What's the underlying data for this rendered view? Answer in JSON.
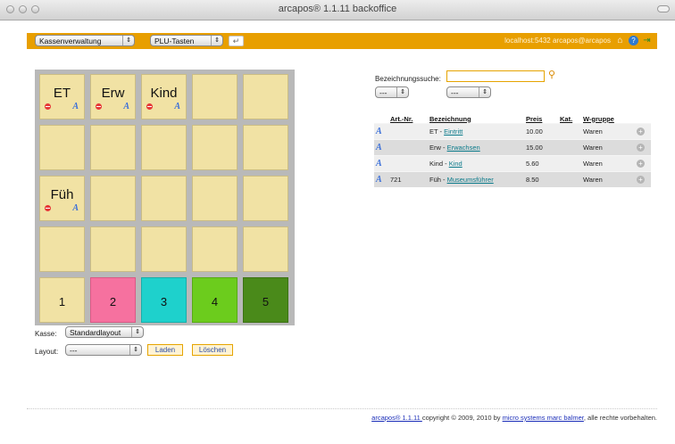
{
  "window": {
    "title": "arcapos® 1.1.11 backoffice"
  },
  "topbar": {
    "menu1": "Kassenverwaltung",
    "menu2": "PLU-Tasten",
    "enter_icon": "↵",
    "server": "localhost:5432 arcapos@arcapos",
    "icons": [
      "home-icon",
      "help-icon",
      "exit-icon"
    ]
  },
  "grid": {
    "row1": [
      {
        "label": "ET",
        "actions": true
      },
      {
        "label": "Erw",
        "actions": true
      },
      {
        "label": "Kind",
        "actions": true
      },
      {
        "label": "",
        "actions": false
      },
      {
        "label": "",
        "actions": false
      }
    ],
    "row3": [
      {
        "label": "Füh",
        "actions": true
      }
    ],
    "numbers": [
      {
        "label": "1",
        "color": "#f1e2a4"
      },
      {
        "label": "2",
        "color": "#f6719f"
      },
      {
        "label": "3",
        "color": "#1ed1cc"
      },
      {
        "label": "4",
        "color": "#6ccc1d"
      },
      {
        "label": "5",
        "color": "#4a8a1a"
      }
    ],
    "edit_glyph": "A"
  },
  "kasse": {
    "label": "Kasse:",
    "value": "Standardlayout"
  },
  "layout": {
    "label": "Layout:",
    "value": "---",
    "load": "Laden",
    "delete": "Löschen"
  },
  "search": {
    "label": "Bezeichnungssuche:",
    "filter1": "---",
    "filter2": "---"
  },
  "table": {
    "headers": [
      "Art.-Nr.",
      "Bezeichnung",
      "Preis",
      "Kat.",
      "W-gruppe"
    ],
    "rows": [
      {
        "artnr": "",
        "prefix": "ET - ",
        "name": "Eintritt",
        "price": "10.00",
        "kat": "",
        "group": "Waren"
      },
      {
        "artnr": "",
        "prefix": "Erw - ",
        "name": "Erwachsen",
        "price": "15.00",
        "kat": "",
        "group": "Waren"
      },
      {
        "artnr": "",
        "prefix": "Kind - ",
        "name": "Kind",
        "price": "5.60",
        "kat": "",
        "group": "Waren"
      },
      {
        "artnr": "721",
        "prefix": "Füh - ",
        "name": "Museumsführer",
        "price": "8.50",
        "kat": "",
        "group": "Waren"
      }
    ]
  },
  "footer": {
    "link1": "arcapos® 1.1.11 ",
    "text1": "copyright © 2009, 2010 by ",
    "link2": "micro systems marc balmer",
    "text2": ", alle rechte vorbehalten."
  },
  "colors": {
    "accent": "#e89f00",
    "cell": "#f1e2a4"
  }
}
